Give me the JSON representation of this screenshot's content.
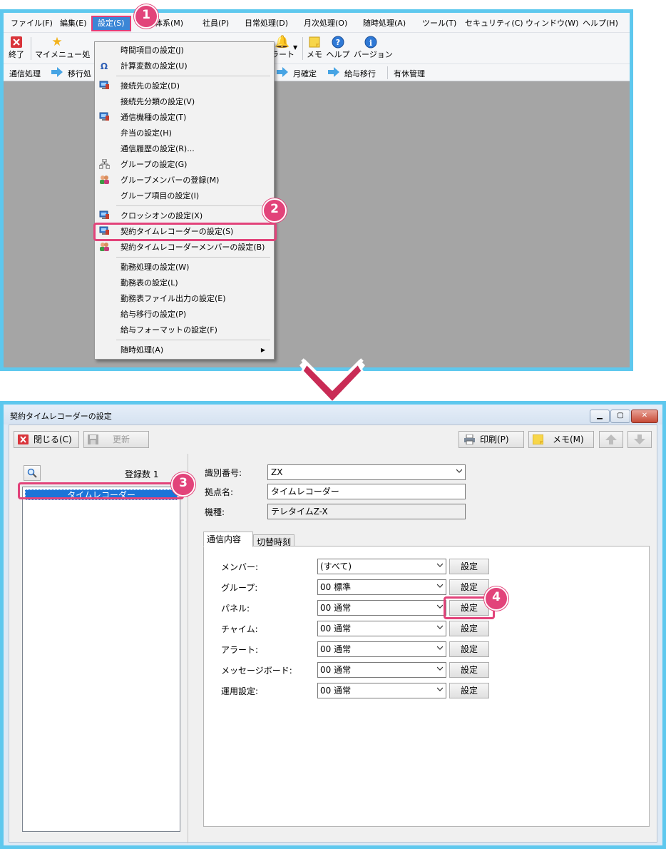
{
  "menubar": {
    "items": [
      "ファイル(F)",
      "編集(E)",
      "設定(S)",
      "体系(M)",
      "社員(P)",
      "日常処理(D)",
      "月次処理(O)",
      "随時処理(A)",
      "ツール(T)",
      "セキュリティ(C)",
      "ウィンドウ(W)",
      "ヘルプ(H)"
    ]
  },
  "toolbar": {
    "exit": "終了",
    "mymenu": "マイメニュー",
    "process_partial": "処",
    "alert_partial": "ラート",
    "memo": "メモ",
    "help": "ヘルプ",
    "version": "バージョン"
  },
  "flowbar": {
    "comm": "通信処理",
    "transfer_partial": "移行処",
    "month_close": "月確定",
    "salary_transfer": "給与移行",
    "paid_leave": "有休管理"
  },
  "dropdown": {
    "items": [
      {
        "label": "時間項目の設定(J)",
        "icon": ""
      },
      {
        "label": "計算変数の設定(U)",
        "icon": "omega-icon"
      },
      {
        "label": "接続先の設定(D)",
        "icon": "computer-icon"
      },
      {
        "label": "接続先分類の設定(V)",
        "icon": ""
      },
      {
        "label": "通信機種の設定(T)",
        "icon": "computer-icon"
      },
      {
        "label": "弁当の設定(H)",
        "icon": ""
      },
      {
        "label": "通信履歴の設定(R)...",
        "icon": ""
      },
      {
        "label": "グループの設定(G)",
        "icon": "tree-icon"
      },
      {
        "label": "グループメンバーの登録(M)",
        "icon": "users-icon"
      },
      {
        "label": "グループ項目の設定(I)",
        "icon": ""
      },
      {
        "label": "クロッシオンの設定(X)",
        "icon": "computer-icon"
      },
      {
        "label": "契約タイムレコーダーの設定(S)",
        "icon": "computer-icon"
      },
      {
        "label": "契約タイムレコーダーメンバーの設定(B)",
        "icon": "users-icon"
      },
      {
        "label": "勤務処理の設定(W)",
        "icon": ""
      },
      {
        "label": "勤務表の設定(L)",
        "icon": ""
      },
      {
        "label": "勤務表ファイル出力の設定(E)",
        "icon": ""
      },
      {
        "label": "給与移行の設定(P)",
        "icon": ""
      },
      {
        "label": "給与フォーマットの設定(F)",
        "icon": ""
      },
      {
        "label": "随時処理(A)",
        "icon": ""
      }
    ]
  },
  "callouts": [
    "1",
    "2",
    "3",
    "4"
  ],
  "window": {
    "title": "契約タイムレコーダーの設定",
    "close_label": "閉じる(C)",
    "update_label": "更新",
    "print_label": "印刷(P)",
    "memo_label": "メモ(M)",
    "register_count": "登録数 1",
    "list_items": [
      "タイムレコーダー"
    ],
    "fields": {
      "id_label": "識別番号:",
      "id_value": "ZX",
      "site_label": "拠点名:",
      "site_value": "タイムレコーダー",
      "model_label": "機種:",
      "model_value": "テレタイムZ-X"
    },
    "tabs": [
      "通信内容",
      "切替時刻"
    ],
    "set_button": "設定",
    "rows": [
      {
        "label": "メンバー:",
        "value": "(すべて)"
      },
      {
        "label": "グループ:",
        "value": "00 標準"
      },
      {
        "label": "パネル:",
        "value": "00 通常"
      },
      {
        "label": "チャイム:",
        "value": "00 通常"
      },
      {
        "label": "アラート:",
        "value": "00 通常"
      },
      {
        "label": "メッセージボード:",
        "value": "00 通常"
      },
      {
        "label": "運用設定:",
        "value": "00 通常"
      }
    ]
  },
  "colors": {
    "highlight": "#e2437a",
    "frame": "#5ec8ee",
    "selection": "#1c74d8",
    "menu_active": "#3b86d6"
  }
}
